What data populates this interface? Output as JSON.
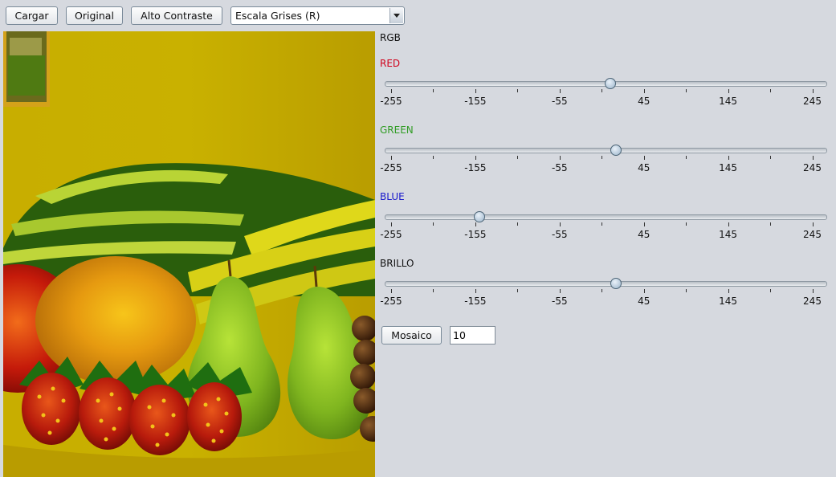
{
  "toolbar": {
    "load_label": "Cargar",
    "original_label": "Original",
    "high_contrast_label": "Alto Contraste",
    "filter_select": {
      "selected": "Escala Grises (R)"
    }
  },
  "image": {
    "description_icon": "image-canvas"
  },
  "controls": {
    "rgb_label": "RGB",
    "colors": {
      "red": "#d0021b",
      "green": "#2f9c23",
      "blue": "#1c1ccc"
    },
    "sliders": [
      {
        "label": "RED",
        "value": 5
      },
      {
        "label": "GREEN",
        "value": 12
      },
      {
        "label": "BLUE",
        "value": -150
      },
      {
        "label": "BRILLO",
        "value": 12
      }
    ],
    "range": {
      "min": -255,
      "max": 255
    },
    "tick_labels": [
      "-255",
      "-155",
      "-55",
      "45",
      "145",
      "245"
    ]
  },
  "mosaic": {
    "button_label": "Mosaico",
    "value": "10"
  }
}
